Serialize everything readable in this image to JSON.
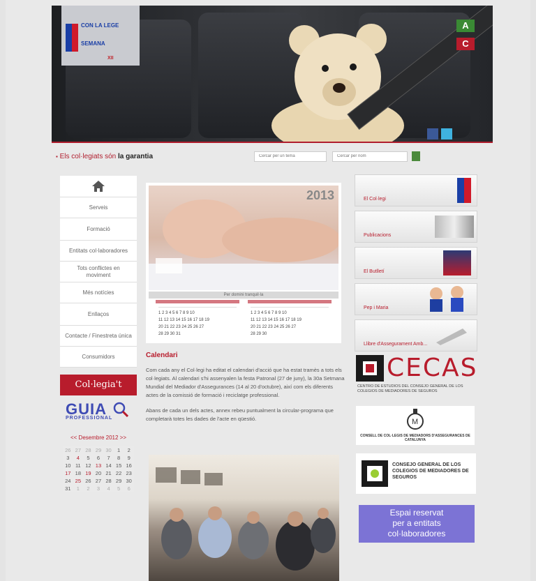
{
  "header": {
    "logo_title": "CON LA LEGE",
    "logo_subtitle": "SEMANA",
    "logo_small": "XII",
    "font_increase": "A",
    "font_decrease": "C",
    "accent_color": "#b01d2d"
  },
  "tagline": {
    "part1": "Els col·legiats són",
    "part2": "la garantia"
  },
  "search": {
    "placeholder1": "Cercar per un tema",
    "placeholder2": "Cercar per nom"
  },
  "left_nav": {
    "items": [
      "Serveis",
      "Formació",
      "Entitats col·laboradores",
      "Tots conflictes en moviment",
      "Més notícies",
      "Enllaços",
      "Contacte / Finestreta única",
      "Consumidors"
    ],
    "colleague_button": "Col·legia't"
  },
  "guia": {
    "title": "GUIA",
    "subtitle": "PROFESSIONAL"
  },
  "mini_calendar": {
    "header": "<< Desembre 2012 >>",
    "rows": [
      [
        "26",
        "27",
        "28",
        "29",
        "30",
        "1",
        "2"
      ],
      [
        "3",
        "4",
        "5",
        "6",
        "7",
        "8",
        "9"
      ],
      [
        "10",
        "11",
        "12",
        "13",
        "14",
        "15",
        "16"
      ],
      [
        "17",
        "18",
        "19",
        "20",
        "21",
        "22",
        "23"
      ],
      [
        "24",
        "25",
        "26",
        "27",
        "28",
        "29",
        "30"
      ],
      [
        "31",
        "1",
        "2",
        "3",
        "4",
        "5",
        "6"
      ]
    ]
  },
  "promo": {
    "year": "2013",
    "caption": "Per domini tranquil·la",
    "heading": "Calendari",
    "paragraph1": "Com cada any el Col·legi ha editat el calendari d'acció que ha estat tramès a tots els col·legiats. Al calendari s'hi assenyalen la festa Patronal (27 de juny), la 30a Setmana Mundial del Mediador d'Assegurances (14 al 20 d'octubre), així com els diferents actes de la comissió de formació i reciclatge professional.",
    "paragraph2": "Abans de cada un dels actes, annex rebeu puntualment la circular-programa que completarà totes les dades de l'acte en qüestió."
  },
  "right_boxes": [
    {
      "label": "El Col·legi"
    },
    {
      "label": "Publicacions"
    },
    {
      "label": "El Butlletí"
    },
    {
      "label": "Pep i Maria"
    },
    {
      "label": "Llibre d'Assegurament Amb..."
    }
  ],
  "cecas": {
    "word": "CECAS",
    "subtitle": "CENTRO DE ESTUDIOS DEL CONSEJO GENERAL DE LOS COLEGIOS DE MEDIADORES DE SEGUROS"
  },
  "consell": {
    "text": "CONSELL DE COL·LEGIS DE MEDIADORS D'ASSEGURANCES DE CATALUNYA"
  },
  "cgm": {
    "text": "CONSEJO GENERAL DE LOS COLEGIOS DE MEDIADORES DE SEGUROS"
  },
  "reserved": {
    "line1": "Espai reservat",
    "line2": "per a entitats",
    "line3": "col·laboradores"
  }
}
